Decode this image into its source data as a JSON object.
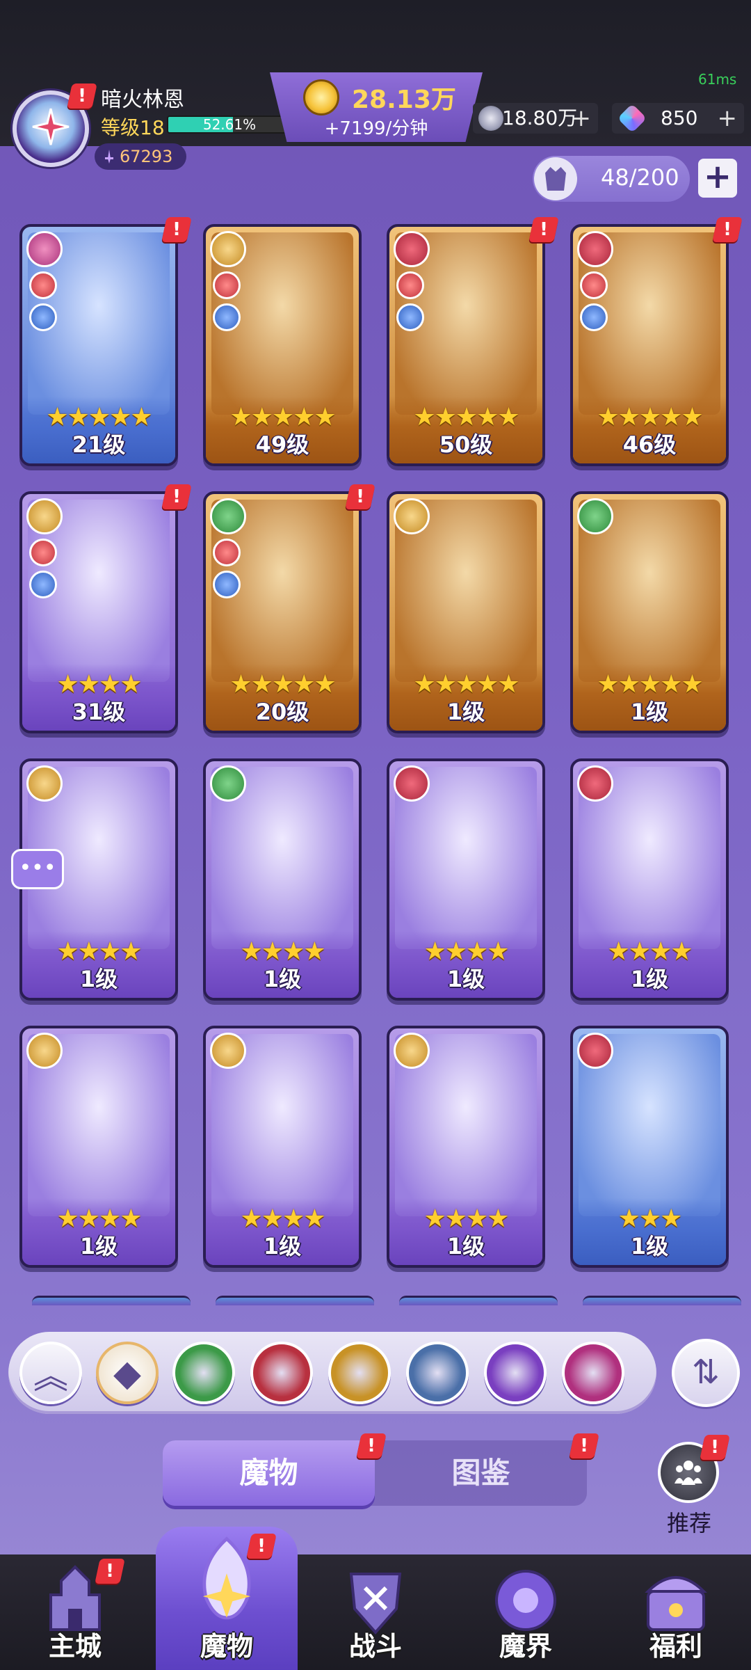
{
  "header": {
    "fps": "61ms",
    "player_name": "暗火林恩",
    "player_level": "等级18",
    "exp_percent": "52.61%",
    "exp_fraction": 0.5261,
    "power": "67293",
    "gold_amount": "28.13万",
    "gold_rate": "+7199/分钟",
    "gems": "18.80万",
    "crystals": "850",
    "box_count": "48/200"
  },
  "cards": [
    {
      "level": "21级",
      "stars": 5,
      "frame": "blue",
      "faction": "void",
      "alert": true,
      "roles": [
        "atk",
        "def"
      ]
    },
    {
      "level": "49级",
      "stars": 5,
      "frame": "gold",
      "faction": "order",
      "alert": false,
      "roles": [
        "atk",
        "def"
      ]
    },
    {
      "level": "50级",
      "stars": 5,
      "frame": "gold",
      "faction": "chaos",
      "alert": true,
      "roles": [
        "atk",
        "def"
      ]
    },
    {
      "level": "46级",
      "stars": 5,
      "frame": "gold",
      "faction": "chaos",
      "alert": true,
      "roles": [
        "atk",
        "def"
      ]
    },
    {
      "level": "31级",
      "stars": 4,
      "frame": "purple",
      "faction": "order",
      "alert": true,
      "roles": [
        "atk",
        "def"
      ]
    },
    {
      "level": "20级",
      "stars": 5,
      "frame": "gold",
      "faction": "nature",
      "alert": true,
      "roles": [
        "atk",
        "def"
      ]
    },
    {
      "level": "1级",
      "stars": 5,
      "frame": "gold",
      "faction": "order",
      "alert": false,
      "roles": []
    },
    {
      "level": "1级",
      "stars": 5,
      "frame": "gold",
      "faction": "nature",
      "alert": false,
      "roles": []
    },
    {
      "level": "1级",
      "stars": 4,
      "frame": "purple",
      "faction": "order",
      "alert": false,
      "roles": []
    },
    {
      "level": "1级",
      "stars": 4,
      "frame": "purple",
      "faction": "nature",
      "alert": false,
      "roles": []
    },
    {
      "level": "1级",
      "stars": 4,
      "frame": "purple",
      "faction": "chaos",
      "alert": false,
      "roles": []
    },
    {
      "level": "1级",
      "stars": 4,
      "frame": "purple",
      "faction": "chaos",
      "alert": false,
      "roles": []
    },
    {
      "level": "1级",
      "stars": 4,
      "frame": "purple",
      "faction": "order",
      "alert": false,
      "roles": []
    },
    {
      "level": "1级",
      "stars": 4,
      "frame": "purple",
      "faction": "order",
      "alert": false,
      "roles": []
    },
    {
      "level": "1级",
      "stars": 4,
      "frame": "purple",
      "faction": "order",
      "alert": false,
      "roles": []
    },
    {
      "level": "1级",
      "stars": 3,
      "frame": "blue",
      "faction": "chaos",
      "alert": false,
      "roles": []
    }
  ],
  "filters": [
    {
      "name": "nature-faction-filter",
      "color": "#3c9a48"
    },
    {
      "name": "chaos-faction-filter",
      "color": "#b8303f"
    },
    {
      "name": "order-faction-filter",
      "color": "#c89226"
    },
    {
      "name": "dragon-faction-filter",
      "color": "#4a6fa8"
    },
    {
      "name": "eye-faction-filter",
      "color": "#7a3fc0"
    },
    {
      "name": "void-faction-filter",
      "color": "#b0307e"
    }
  ],
  "tabs": {
    "monster": "魔物",
    "codex": "图鉴"
  },
  "recommend_label": "推荐",
  "nav": [
    {
      "label": "主城",
      "icon": "castle-icon",
      "alert": true
    },
    {
      "label": "魔物",
      "icon": "monster-flame-icon",
      "alert": true
    },
    {
      "label": "战斗",
      "icon": "battle-shield-icon",
      "alert": false
    },
    {
      "label": "魔界",
      "icon": "demon-realm-icon",
      "alert": false
    },
    {
      "label": "福利",
      "icon": "treasure-chest-icon",
      "alert": false
    }
  ]
}
